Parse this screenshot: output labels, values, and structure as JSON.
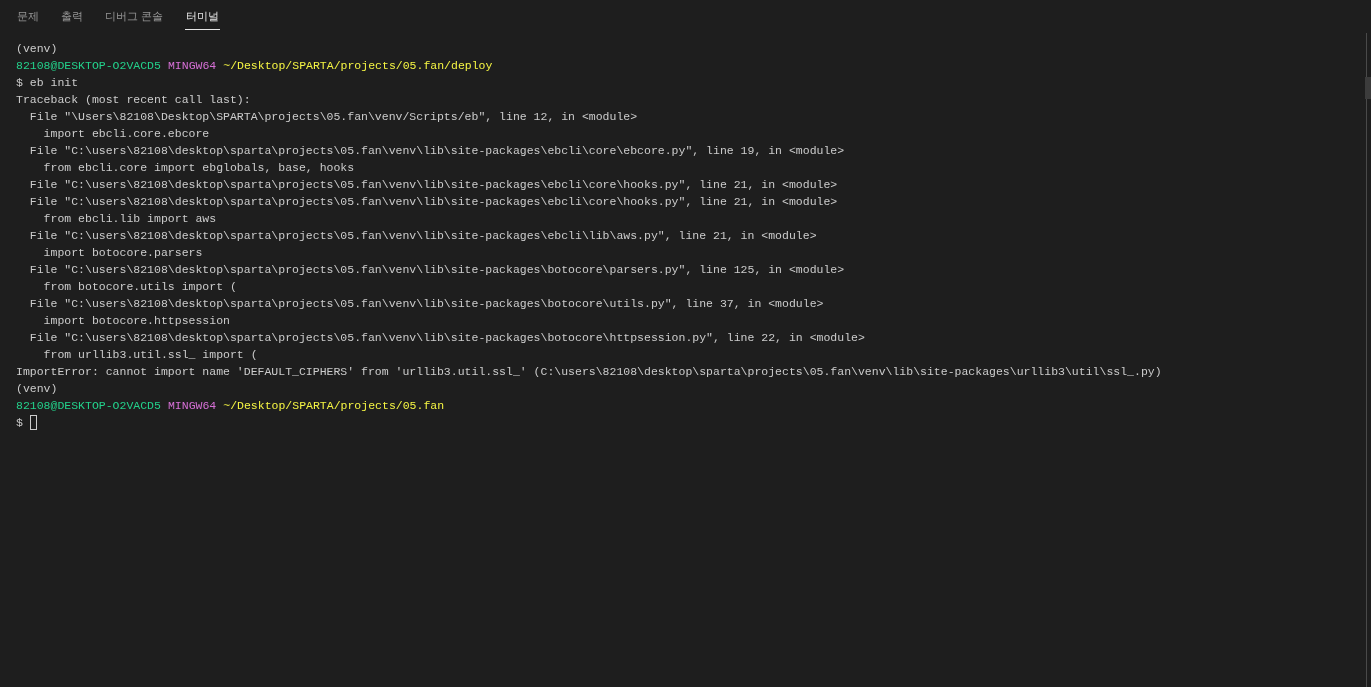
{
  "tabs": [
    {
      "label": "문제",
      "selected": false
    },
    {
      "label": "출력",
      "selected": false
    },
    {
      "label": "디버그 콘솔",
      "selected": false
    },
    {
      "label": "터미널",
      "selected": true
    }
  ],
  "terminal": {
    "lines": [
      {
        "kind": "plain",
        "text": "(venv)"
      },
      {
        "kind": "prompt",
        "user": "82108@DESKTOP-O2VACD5",
        "shell": "MINGW64",
        "path": "~/Desktop/SPARTA/projects/05.fan/deploy"
      },
      {
        "kind": "plain",
        "text": "$ eb init"
      },
      {
        "kind": "plain",
        "text": "Traceback (most recent call last):"
      },
      {
        "kind": "plain",
        "text": "  File \"\\Users\\82108\\Desktop\\SPARTA\\projects\\05.fan\\venv/Scripts/eb\", line 12, in <module>"
      },
      {
        "kind": "plain",
        "text": "    import ebcli.core.ebcore"
      },
      {
        "kind": "plain",
        "text": "  File \"C:\\users\\82108\\desktop\\sparta\\projects\\05.fan\\venv\\lib\\site-packages\\ebcli\\core\\ebcore.py\", line 19, in <module>"
      },
      {
        "kind": "plain",
        "text": "    from ebcli.core import ebglobals, base, hooks"
      },
      {
        "kind": "plain",
        "text": "  File \"C:\\users\\82108\\desktop\\sparta\\projects\\05.fan\\venv\\lib\\site-packages\\ebcli\\core\\hooks.py\", line 21, in <module>"
      },
      {
        "kind": "plain",
        "text": "  File \"C:\\users\\82108\\desktop\\sparta\\projects\\05.fan\\venv\\lib\\site-packages\\ebcli\\core\\hooks.py\", line 21, in <module>"
      },
      {
        "kind": "plain",
        "text": "    from ebcli.lib import aws"
      },
      {
        "kind": "plain",
        "text": "  File \"C:\\users\\82108\\desktop\\sparta\\projects\\05.fan\\venv\\lib\\site-packages\\ebcli\\lib\\aws.py\", line 21, in <module>"
      },
      {
        "kind": "plain",
        "text": "    import botocore.parsers"
      },
      {
        "kind": "plain",
        "text": "  File \"C:\\users\\82108\\desktop\\sparta\\projects\\05.fan\\venv\\lib\\site-packages\\botocore\\parsers.py\", line 125, in <module>"
      },
      {
        "kind": "plain",
        "text": "    from botocore.utils import ("
      },
      {
        "kind": "plain",
        "text": "  File \"C:\\users\\82108\\desktop\\sparta\\projects\\05.fan\\venv\\lib\\site-packages\\botocore\\utils.py\", line 37, in <module>"
      },
      {
        "kind": "plain",
        "text": "    import botocore.httpsession"
      },
      {
        "kind": "plain",
        "text": "  File \"C:\\users\\82108\\desktop\\sparta\\projects\\05.fan\\venv\\lib\\site-packages\\botocore\\httpsession.py\", line 22, in <module>"
      },
      {
        "kind": "plain",
        "text": "    from urllib3.util.ssl_ import ("
      },
      {
        "kind": "plain",
        "text": "ImportError: cannot import name 'DEFAULT_CIPHERS' from 'urllib3.util.ssl_' (C:\\users\\82108\\desktop\\sparta\\projects\\05.fan\\venv\\lib\\site-packages\\urllib3\\util\\ssl_.py)"
      },
      {
        "kind": "plain",
        "text": "(venv)"
      },
      {
        "kind": "prompt",
        "user": "82108@DESKTOP-O2VACD5",
        "shell": "MINGW64",
        "path": "~/Desktop/SPARTA/projects/05.fan"
      },
      {
        "kind": "input",
        "text": "$"
      }
    ]
  }
}
